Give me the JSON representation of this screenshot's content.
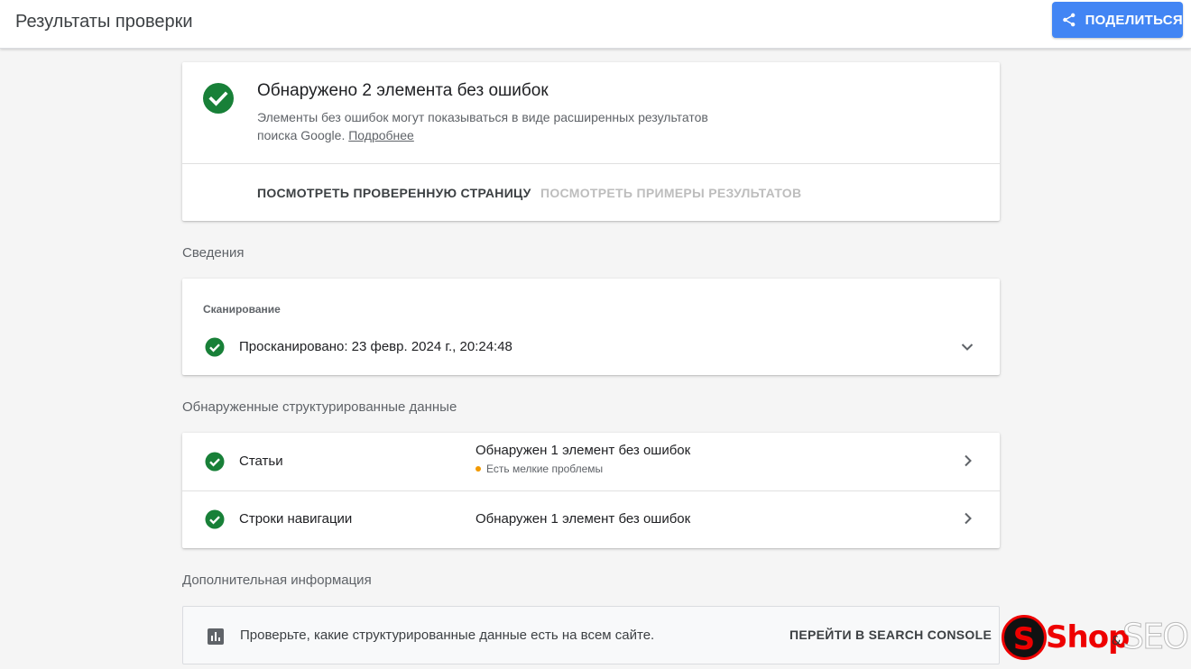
{
  "header": {
    "title": "Результаты проверки",
    "share_label": "ПОДЕЛИТЬСЯ"
  },
  "summary": {
    "title": "Обнаружено 2 элемента без ошибок",
    "description_line1": "Элементы без ошибок могут показываться в виде расширенных результатов",
    "description_line2": "поиска Google. ",
    "learn_more_link": "Подробнее",
    "action_view_page": "ПОСМОТРЕТЬ ПРОВЕРЕННУЮ СТРАНИЦУ",
    "action_view_examples": "ПОСМОТРЕТЬ ПРИМЕРЫ РЕЗУЛЬТАТОВ"
  },
  "details": {
    "section_label": "Сведения",
    "crawl_label": "Сканирование",
    "crawl_text": "Просканировано: 23 февр. 2024 г., 20:24:48"
  },
  "structured_data": {
    "section_label": "Обнаруженные структурированные данные",
    "rows": [
      {
        "name": "Статьи",
        "status": "Обнаружен 1 элемент без ошибок",
        "warning": "Есть мелкие проблемы"
      },
      {
        "name": "Строки навигации",
        "status": "Обнаружен 1 элемент без ошибок"
      }
    ]
  },
  "additional": {
    "section_label": "Дополнительная информация",
    "text": "Проверьте, какие структурированные данные есть на всем сайте.",
    "action": "ПЕРЕЙТИ В SEARCH CONSOLE"
  },
  "watermark": {
    "logo_letter": "S",
    "shop": "Shop",
    "amp": "&",
    "seo": "SEO"
  },
  "colors": {
    "success_green": "#188038",
    "share_blue": "#4285f4",
    "warning_orange": "#f29900"
  },
  "icons": [
    "share-icon",
    "check-circle-icon",
    "chevron-down-icon",
    "chevron-right-icon",
    "bar-chart-icon"
  ]
}
